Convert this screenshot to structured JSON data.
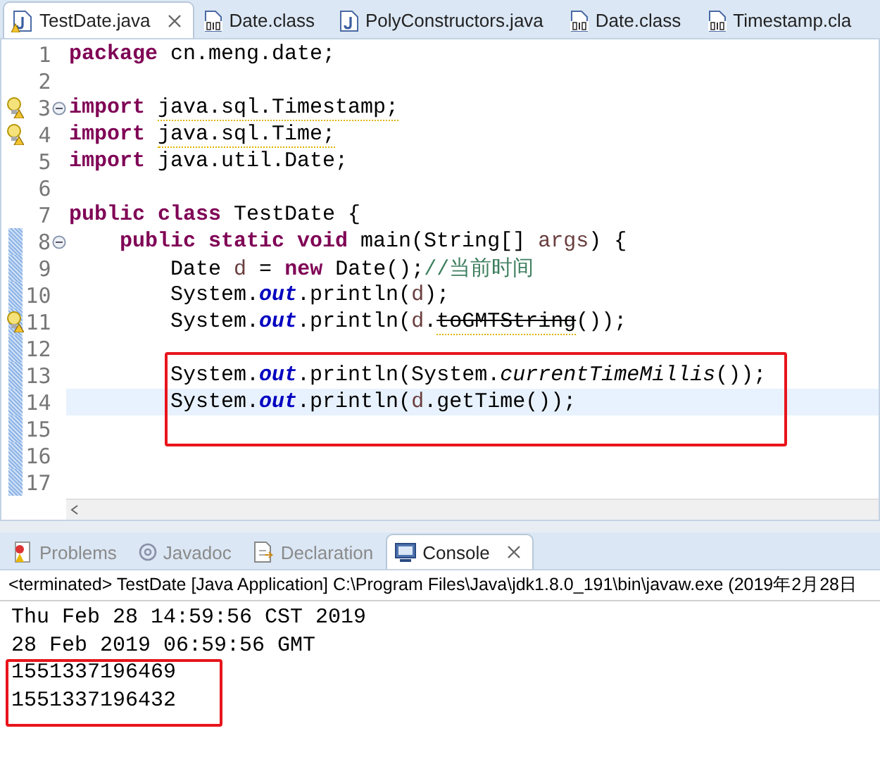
{
  "editor_tabs": [
    {
      "label": "TestDate.java",
      "kind": "java",
      "warning": true,
      "selected": true,
      "closable": true
    },
    {
      "label": "Date.class",
      "kind": "class",
      "warning": false,
      "selected": false,
      "closable": false
    },
    {
      "label": "PolyConstructors.java",
      "kind": "java",
      "warning": false,
      "selected": false,
      "closable": false
    },
    {
      "label": "Date.class",
      "kind": "class",
      "warning": false,
      "selected": false,
      "closable": false
    },
    {
      "label": "Timestamp.cla",
      "kind": "class",
      "warning": false,
      "selected": false,
      "closable": false
    }
  ],
  "code_lines": [
    {
      "number": "1",
      "warning": false,
      "foldable": false,
      "changed": false,
      "current": false,
      "tokens": [
        {
          "kind": "kw",
          "t": "package"
        },
        {
          "kind": "plain",
          "t": " cn.meng.date;"
        }
      ]
    },
    {
      "number": "2",
      "warning": false,
      "foldable": false,
      "changed": false,
      "current": false
    },
    {
      "number": "3",
      "warning": true,
      "foldable": true,
      "changed": false,
      "current": false,
      "tokens": [
        {
          "kind": "kw",
          "t": "import "
        },
        {
          "kind": "warn",
          "t": "java.sql.Timestamp;"
        }
      ]
    },
    {
      "number": "4",
      "warning": true,
      "foldable": false,
      "changed": false,
      "current": false,
      "tokens": [
        {
          "kind": "kw",
          "t": "import "
        },
        {
          "kind": "warn",
          "t": "java.sql.Time;"
        }
      ]
    },
    {
      "number": "5",
      "warning": false,
      "foldable": false,
      "changed": false,
      "current": false,
      "tokens": [
        {
          "kind": "kw",
          "t": "import"
        },
        {
          "kind": "plain",
          "t": " java.util.Date;"
        }
      ]
    },
    {
      "number": "6",
      "warning": false,
      "foldable": false,
      "changed": false,
      "current": false
    },
    {
      "number": "7",
      "warning": false,
      "foldable": false,
      "changed": false,
      "current": false,
      "tokens": [
        {
          "kind": "kw",
          "t": "public class"
        },
        {
          "kind": "plain",
          "t": " TestDate {"
        }
      ]
    },
    {
      "number": "8",
      "warning": false,
      "foldable": true,
      "changed": true,
      "current": false,
      "tokens": [
        {
          "kind": "kw",
          "t": "    public static void"
        },
        {
          "kind": "plain",
          "t": " main(String[] "
        },
        {
          "kind": "local",
          "t": "args"
        },
        {
          "kind": "plain",
          "t": ") {"
        }
      ]
    },
    {
      "number": "9",
      "warning": false,
      "foldable": false,
      "changed": true,
      "current": false,
      "tokens": [
        {
          "kind": "plain",
          "t": "        Date "
        },
        {
          "kind": "local",
          "t": "d"
        },
        {
          "kind": "plain",
          "t": " = "
        },
        {
          "kind": "kw",
          "t": "new"
        },
        {
          "kind": "plain",
          "t": " Date();"
        },
        {
          "kind": "comment",
          "t": "//当前时间"
        }
      ]
    },
    {
      "number": "10",
      "warning": false,
      "foldable": false,
      "changed": true,
      "current": false,
      "tokens": [
        {
          "kind": "plain",
          "t": "        System."
        },
        {
          "kind": "field",
          "t": "out"
        },
        {
          "kind": "plain",
          "t": ".println("
        },
        {
          "kind": "local",
          "t": "d"
        },
        {
          "kind": "plain",
          "t": ");"
        }
      ]
    },
    {
      "number": "11",
      "warning": true,
      "foldable": false,
      "changed": true,
      "current": false,
      "tokens": [
        {
          "kind": "plain",
          "t": "        System."
        },
        {
          "kind": "field",
          "t": "out"
        },
        {
          "kind": "plain",
          "t": ".println("
        },
        {
          "kind": "local",
          "t": "d"
        },
        {
          "kind": "plain",
          "t": "."
        },
        {
          "kind": "deprecated",
          "t": "toGMTString"
        },
        {
          "kind": "plain",
          "t": "());"
        }
      ]
    },
    {
      "number": "12",
      "warning": false,
      "foldable": false,
      "changed": true,
      "current": false
    },
    {
      "number": "13",
      "warning": false,
      "foldable": false,
      "changed": true,
      "current": false,
      "tokens": [
        {
          "kind": "plain",
          "t": "        System."
        },
        {
          "kind": "field",
          "t": "out"
        },
        {
          "kind": "plain",
          "t": ".println(System."
        },
        {
          "kind": "static",
          "t": "currentTimeMillis"
        },
        {
          "kind": "plain",
          "t": "());"
        }
      ]
    },
    {
      "number": "14",
      "warning": false,
      "foldable": false,
      "changed": true,
      "current": true,
      "tokens": [
        {
          "kind": "plain",
          "t": "        System."
        },
        {
          "kind": "field",
          "t": "out"
        },
        {
          "kind": "plain",
          "t": ".println("
        },
        {
          "kind": "local",
          "t": "d"
        },
        {
          "kind": "plain",
          "t": ".getTime());"
        }
      ]
    },
    {
      "number": "15",
      "warning": false,
      "foldable": false,
      "changed": true,
      "current": false
    },
    {
      "number": "16",
      "warning": false,
      "foldable": false,
      "changed": true,
      "current": false
    },
    {
      "number": "17",
      "warning": false,
      "foldable": false,
      "changed": true,
      "current": false
    }
  ],
  "console_tabs": [
    {
      "label": "Problems",
      "selected": false,
      "closable": false
    },
    {
      "label": "Javadoc",
      "selected": false,
      "closable": false
    },
    {
      "label": "Declaration",
      "selected": false,
      "closable": false
    },
    {
      "label": "Console",
      "selected": true,
      "closable": true
    }
  ],
  "console_status": "<terminated> TestDate [Java Application] C:\\Program Files\\Java\\jdk1.8.0_191\\bin\\javaw.exe (2019年2月28日",
  "console_output": [
    "Thu Feb 28 14:59:56 CST 2019",
    "28 Feb 2019 06:59:56 GMT",
    "1551337196469",
    "1551337196432"
  ]
}
